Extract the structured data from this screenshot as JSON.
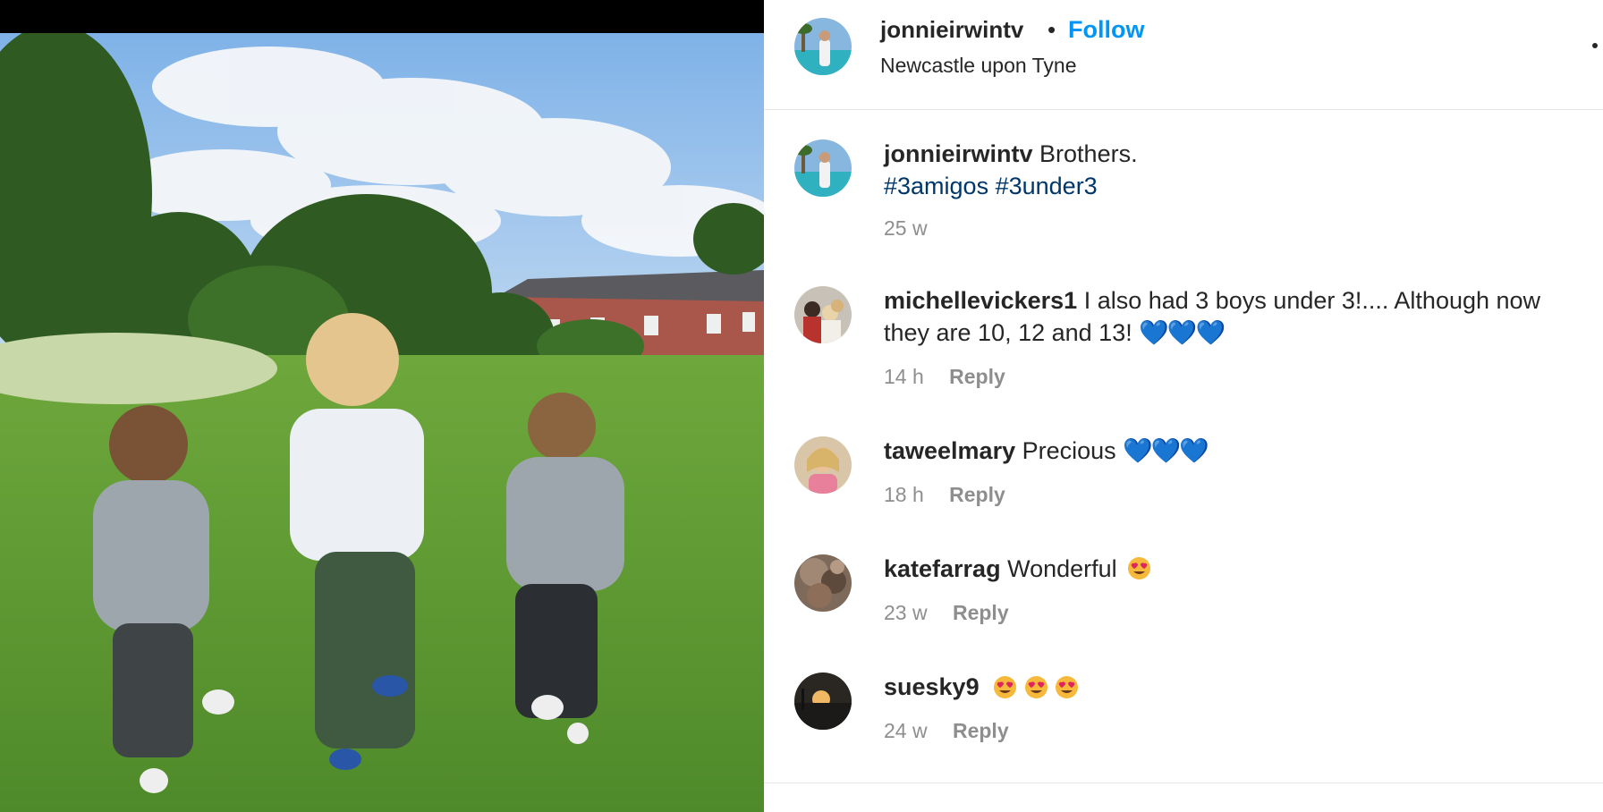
{
  "post": {
    "image_alt": "Three young boys walking hand in hand across a grassy park",
    "author": {
      "username": "jonnieirwintv",
      "separator": "•",
      "follow_label": "Follow",
      "location": "Newcastle upon Tyne"
    },
    "caption": {
      "username": "jonnieirwintv",
      "text": "Brothers.",
      "hashtags": [
        "#3amigos",
        "#3under3"
      ],
      "time": "25 w"
    }
  },
  "comments": [
    {
      "username": "michellevickers1",
      "text": "I also had 3 boys under 3!.... Although now they are 10, 12 and 13!",
      "emoji": "💙💙💙",
      "time": "14 h",
      "reply_label": "Reply"
    },
    {
      "username": "taweelmary",
      "text": "Precious",
      "emoji": "💙💙💙",
      "time": "18 h",
      "reply_label": "Reply"
    },
    {
      "username": "katefarrag",
      "text": "Wonderful",
      "emoji": "😍",
      "time": "23 w",
      "reply_label": "Reply"
    },
    {
      "username": "suesky9",
      "text": "",
      "emoji": "😍😍😍",
      "time": "24 w",
      "reply_label": "Reply"
    }
  ],
  "colors": {
    "follow": "#0095f6",
    "hashtag": "#00376b",
    "meta": "#8e8e8e",
    "heart": "#1877f2"
  },
  "icons": [
    "more-options-icon"
  ]
}
